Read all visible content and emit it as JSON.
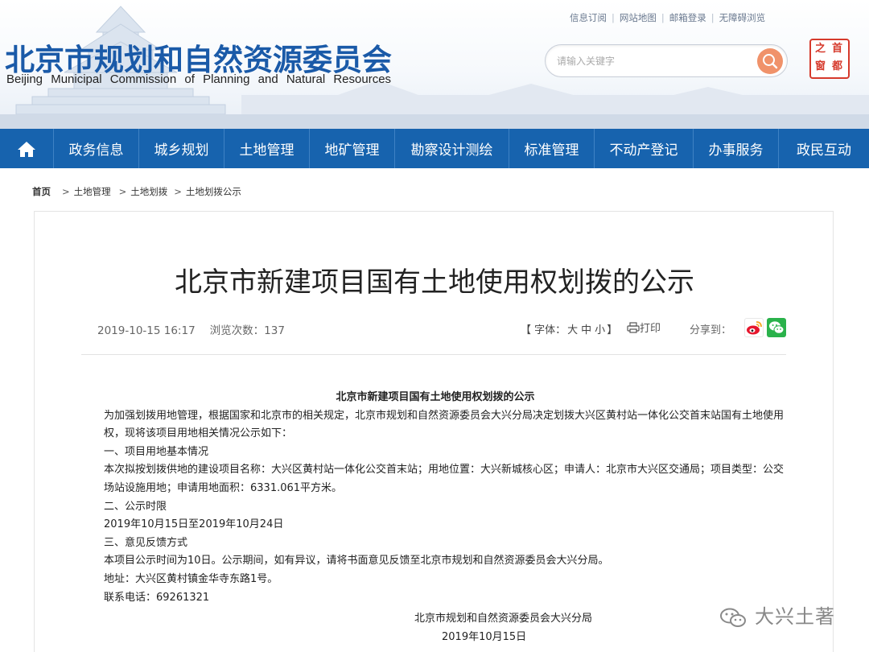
{
  "header": {
    "logo_cn": "北京市规划和自然资源委员会",
    "logo_en": "Beijing Municipal Commission of Planning and Natural Resources",
    "top_links": [
      "信息订阅",
      "网站地图",
      "邮箱登录",
      "无障碍浏览"
    ],
    "search_placeholder": "请输入关键字",
    "seal_chars": [
      "首",
      "都",
      "之",
      "窗"
    ]
  },
  "nav": {
    "home_icon": "home-icon",
    "items": [
      "政务信息",
      "城乡规划",
      "土地管理",
      "地矿管理",
      "勘察设计测绘",
      "标准管理",
      "不动产登记",
      "办事服务",
      "政民互动"
    ]
  },
  "breadcrumb": {
    "home": "首页",
    "items": [
      "土地管理",
      "土地划拨",
      "土地划拨公示"
    ]
  },
  "article": {
    "title": "北京市新建项目国有土地使用权划拨的公示",
    "date": "2019-10-15 16:17",
    "views": "浏览次数：137",
    "font_label_prefix": "【 字体：",
    "font_sizes": [
      "大",
      "中",
      "小"
    ],
    "font_label_suffix": "】",
    "print_label": "打印",
    "share_label": "分享到：",
    "share_icons": [
      "weibo-icon",
      "wechat-icon"
    ],
    "body_heading": "北京市新建项目国有土地使用权划拨的公示",
    "intro": "为加强划拨用地管理，根据国家和北京市的相关规定，北京市规划和自然资源委员会大兴分局决定划拨大兴区黄村站一体化公交首末站国有土地使用权，现将该项目用地相关情况公示如下：",
    "s1_title": "一、项目用地基本情况",
    "s1_text": "本次拟按划拨供地的建设项目名称：大兴区黄村站一体化公交首末站；用地位置：大兴新城核心区；申请人：北京市大兴区交通局；项目类型：公交场站设施用地；申请用地面积：6331.061平方米。",
    "s2_title": "二、公示时限",
    "s2_text": "2019年10月15日至2019年10月24日",
    "s3_title": "三、意见反馈方式",
    "s3_text": "本项目公示时间为10日。公示期间，如有异议，请将书面意见反馈至北京市规划和自然资源委员会大兴分局。",
    "address": "地址：大兴区黄村镇金华寺东路1号。",
    "phone": "联系电话：69261321",
    "signature": "北京市规划和自然资源委员会大兴分局",
    "sign_date": "2019年10月15日"
  },
  "watermark": {
    "text": "大兴土著",
    "icon": "wechat-logo-icon"
  },
  "colors": {
    "nav_bg": "#1763ae",
    "logo": "#1a5aa8",
    "search_btn": "#f0926a",
    "seal": "#d63a2c"
  }
}
